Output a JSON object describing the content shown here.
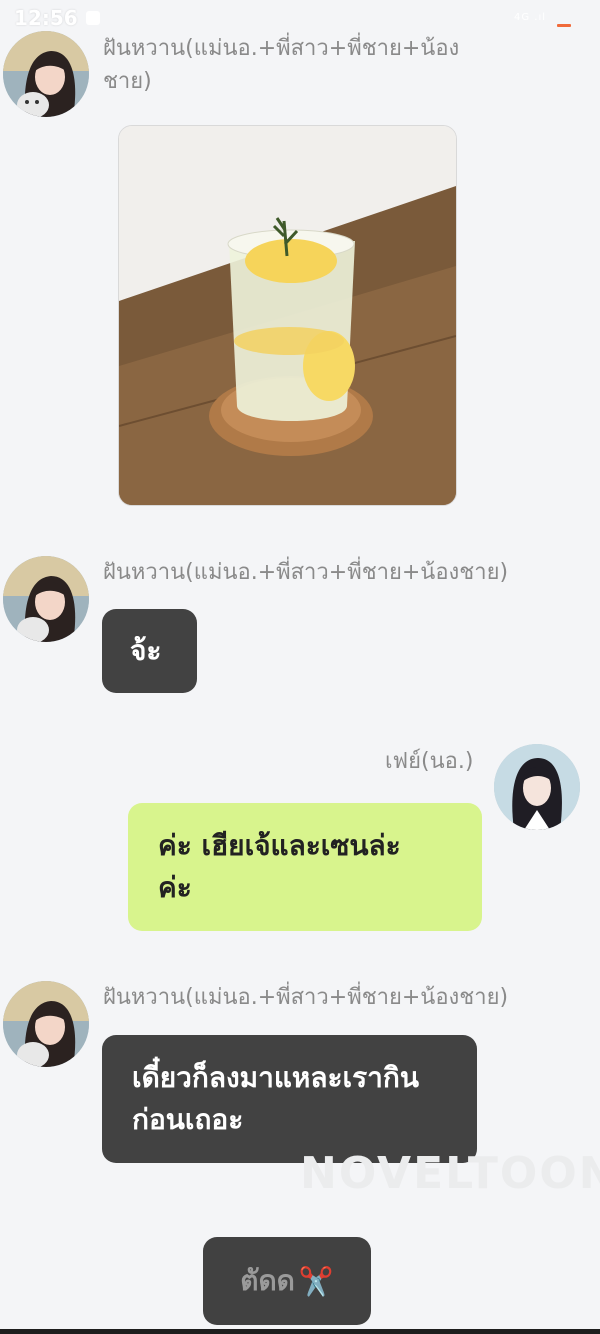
{
  "status_bar": {
    "time": "12:56",
    "signal_text": "4G .ıl"
  },
  "messages": [
    {
      "sender": "ฝันหวาน(แม่นอ.+พี่สาว+พี่ชาย+น้องชาย)",
      "type": "image",
      "image_desc_icon": "lemon-soda-photo"
    },
    {
      "sender": "ฝันหวาน(แม่นอ.+พี่สาว+พี่ชาย+น้องชาย)",
      "type": "text",
      "text": "จ้ะ"
    },
    {
      "sender": "เฟย์(นอ.)",
      "type": "text",
      "text_lines": [
        "ค่ะ เฮียเจ้และเซนล่ะ",
        "ค่ะ"
      ]
    },
    {
      "sender": "ฝันหวาน(แม่นอ.+พี่สาว+พี่ชาย+น้องชาย)",
      "type": "text",
      "text_lines": [
        "เดี๋ยวก็ลงมาแหละเรากิน",
        "ก่อนเถอะ"
      ]
    }
  ],
  "name_lines": [
    "ฝันหวาน(แม่นอ.+พี่สาว+พี่ชาย+น้อง",
    "ชาย)"
  ],
  "watermark": "NOVELTOON",
  "cut_button": {
    "label": "ตัดด",
    "icon": "✂️"
  },
  "colors": {
    "dark_bubble": "#424242",
    "green_bubble": "#d8f48d",
    "background": "#f4f5f7"
  }
}
